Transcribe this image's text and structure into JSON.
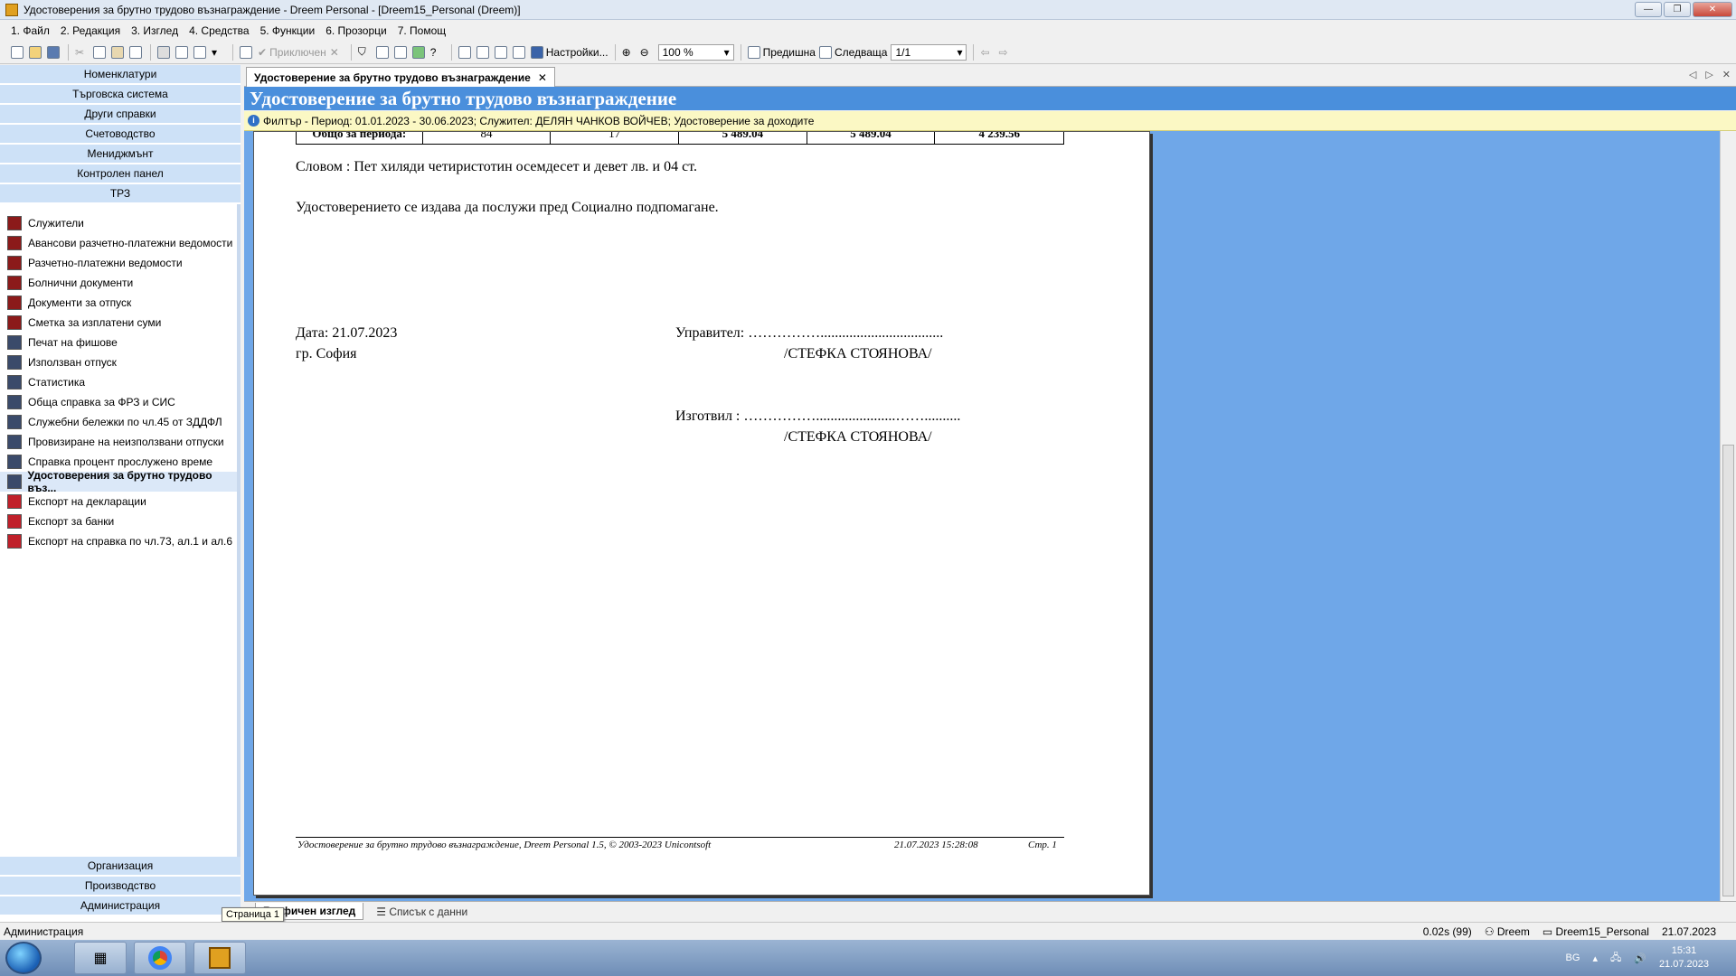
{
  "window": {
    "title": "Удостоверения за брутно трудово възнаграждение - Dreem Personal - [Dreem15_Personal (Dreem)]",
    "buttons": {
      "minimize": "—",
      "restore": "❐",
      "close": "✕"
    }
  },
  "menu": [
    "1. Файл",
    "2. Редакция",
    "3. Изглед",
    "4. Средства",
    "5. Функции",
    "6. Прозорци",
    "7. Помощ"
  ],
  "toolbar": {
    "finished_label": "Приключен",
    "settings_label": "Настройки...",
    "zoom_value": "100 %",
    "previous_label": "Предишна",
    "next_label": "Следваща",
    "page_value": "1/1"
  },
  "sidebar": {
    "groups_top": [
      "Номенклатури",
      "Търговска система",
      "Други справки",
      "Счетоводство",
      "Мениджмънт",
      "Контролен панел",
      "ТРЗ"
    ],
    "items": [
      {
        "label": "Служители",
        "color": "#8b1a1a"
      },
      {
        "label": "Авансови разчетно-платежни ведомости",
        "color": "#8b1a1a"
      },
      {
        "label": "Разчетно-платежни ведомости",
        "color": "#8b1a1a"
      },
      {
        "label": "Болнични документи",
        "color": "#8b1a1a"
      },
      {
        "label": "Документи за отпуск",
        "color": "#8b1a1a"
      },
      {
        "label": "Сметка за изплатени суми",
        "color": "#8b1a1a"
      },
      {
        "label": "Печат на фишове",
        "color": "#3a4a6a"
      },
      {
        "label": "Използван отпуск",
        "color": "#3a4a6a"
      },
      {
        "label": "Статистика",
        "color": "#3a4a6a"
      },
      {
        "label": "Обща справка за ФРЗ и СИС",
        "color": "#3a4a6a"
      },
      {
        "label": "Служебни бележки по чл.45 от ЗДДФЛ",
        "color": "#3a4a6a"
      },
      {
        "label": "Провизиране на неизползвани отпуски",
        "color": "#3a4a6a"
      },
      {
        "label": "Справка процент прослужено време",
        "color": "#3a4a6a"
      },
      {
        "label": "Удостоверения за брутно трудово въз...",
        "color": "#3a4a6a",
        "active": true
      },
      {
        "label": "Експорт на декларации",
        "color": "#c0202a"
      },
      {
        "label": "Експорт за банки",
        "color": "#c0202a"
      },
      {
        "label": "Експорт на справка по чл.73, ал.1 и ал.6",
        "color": "#c0202a"
      }
    ],
    "groups_bottom": [
      "Организация",
      "Производство",
      "Администрация"
    ]
  },
  "document_tab": {
    "label": "Удостоверение за брутно трудово възнаграждение",
    "close": "✕"
  },
  "banner": {
    "title": "Удостоверение за брутно трудово възнаграждение"
  },
  "filter": {
    "text": "Филтър - Период: 01.01.2023 - 30.06.2023; Служител: ДЕЛЯН ЧАНКОВ ВОЙЧЕВ; Удостоверение за доходите"
  },
  "report": {
    "summary_row": [
      "Общо за периода:",
      "84",
      "17",
      "5 489.04",
      "5 489.04",
      "4 239.56"
    ],
    "words": "Словом : Пет хиляди четиристотин осемдесет и девет лв. и 04 ст.",
    "purpose": "Удостоверението се издава да послужи пред Социално подпомагане.",
    "date": "Дата: 21.07.2023",
    "city": "гр. София",
    "manager_label": "Управител: ……………..................................",
    "manager_name": "/СТЕФКА  СТОЯНОВА/",
    "prepared_label": "Изготвил : ……………......................……..........",
    "prepared_name": "/СТЕФКА  СТОЯНОВА/",
    "footer_left": "Удостоверение за брутно трудово възнаграждение, Dreem Personal 1.5, © 2003-2023 Unicontsoft",
    "footer_date": "21.07.2023 15:28:08",
    "footer_page": "Стр. 1"
  },
  "bottom_tabs": {
    "graphic": "Графичен изглед",
    "list": "Списък с данни"
  },
  "tooltip": "Страница 1",
  "status": {
    "left": "Администрация",
    "timing": "0.02s (99)",
    "app": "Dreem",
    "db": "Dreem15_Personal",
    "date": "21.07.2023"
  },
  "taskbar": {
    "lang": "BG",
    "time": "15:31",
    "date": "21.07.2023"
  }
}
